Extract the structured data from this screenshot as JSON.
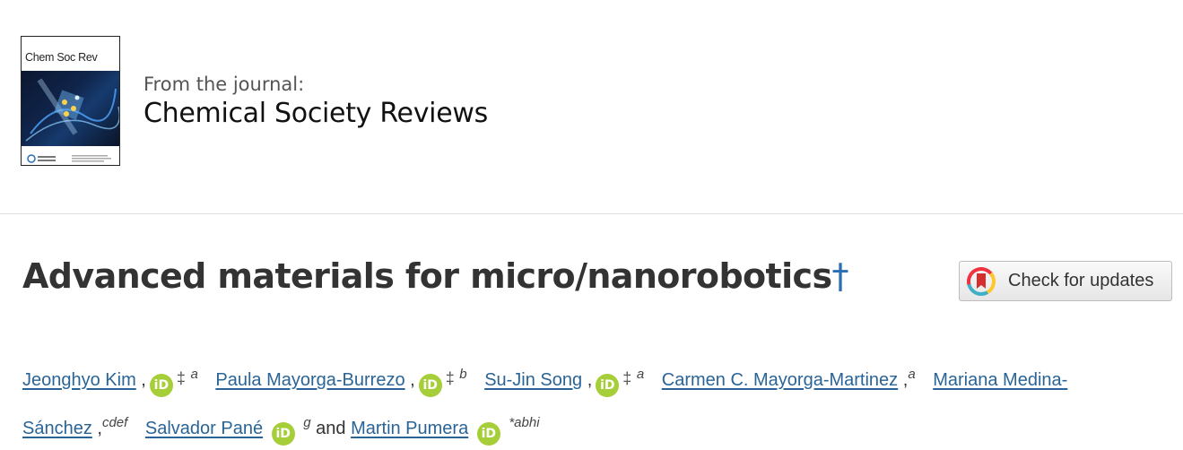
{
  "journal": {
    "cover_title": "Chem Soc Rev",
    "from_label": "From the journal:",
    "name": "Chemical Society Reviews"
  },
  "article": {
    "title": "Advanced materials for micro/nanorobotics",
    "title_dagger": "†"
  },
  "check_updates": {
    "label": "Check for updates"
  },
  "authors": [
    {
      "name": "Jeonghyo Kim",
      "orcid": true,
      "equal": "‡",
      "affil": "a"
    },
    {
      "name": "Paula Mayorga-Burrezo",
      "orcid": true,
      "equal": "‡",
      "affil": "b"
    },
    {
      "name": "Su-Jin Song",
      "orcid": true,
      "equal": "‡",
      "affil": "a"
    },
    {
      "name": "Carmen C. Mayorga-Martinez",
      "orcid": false,
      "equal": "",
      "affil": "a"
    },
    {
      "name_line1": "Mariana Medina-",
      "name_line2": "Sánchez",
      "orcid": false,
      "equal": "",
      "affil": "cdef"
    },
    {
      "name": "Salvador Pané",
      "orcid": true,
      "equal": "",
      "affil": "g"
    },
    {
      "name": "Martin Pumera",
      "orcid": true,
      "equal": "",
      "affil": "*abhi"
    }
  ],
  "authors_conjunction": "and",
  "orcid_icon_text": "iD",
  "colors": {
    "link": "#2a6496",
    "orcid": "#a6ce39",
    "dagger": "#2a6fb2",
    "divider": "#e2e2e2"
  },
  "icons": [
    "orcid-icon",
    "crossmark-icon"
  ]
}
